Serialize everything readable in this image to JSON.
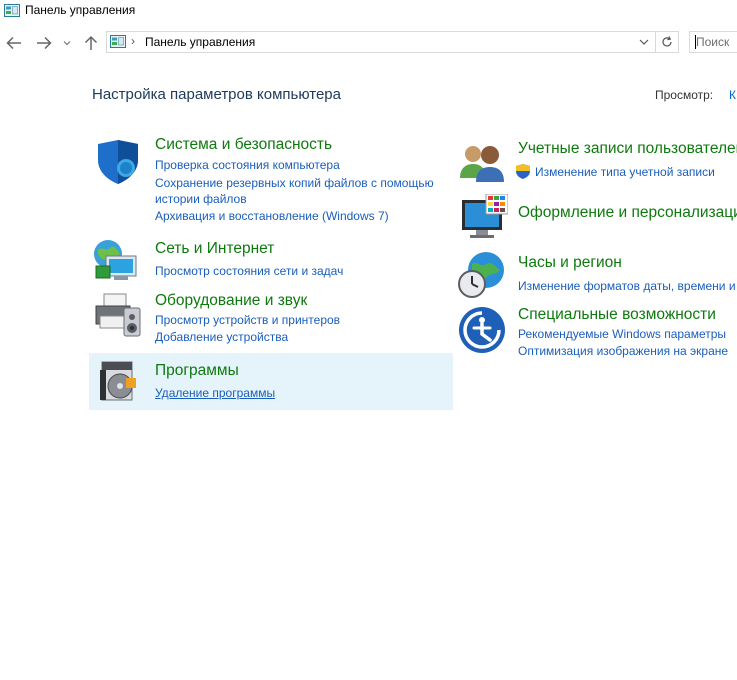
{
  "window": {
    "title": "Панель управления"
  },
  "nav": {
    "breadcrumb": "Панель управления",
    "search_placeholder": "Поиск"
  },
  "header": {
    "title": "Настройка параметров компьютера",
    "view_label": "Просмотр:",
    "view_value": "К"
  },
  "left_categories": [
    {
      "name": "Система и безопасность",
      "links": [
        "Проверка состояния компьютера",
        "Сохранение резервных копий файлов с помощью",
        "истории файлов",
        "Архивация и восстановление (Windows 7)"
      ]
    },
    {
      "name": "Сеть и Интернет",
      "links": [
        "Просмотр состояния сети и задач"
      ]
    },
    {
      "name": "Оборудование и звук",
      "links": [
        "Просмотр устройств и принтеров",
        "Добавление устройства"
      ]
    },
    {
      "name": "Программы",
      "links": [
        "Удаление программы"
      ]
    }
  ],
  "right_categories": [
    {
      "name": "Учетные записи пользователей",
      "links": [
        "Изменение типа учетной записи"
      ]
    },
    {
      "name": "Оформление и персонализация",
      "links": []
    },
    {
      "name": "Часы и регион",
      "links": [
        "Изменение форматов даты, времени и чисел"
      ]
    },
    {
      "name": "Специальные возможности",
      "links": [
        "Рекомендуемые Windows параметры",
        "Оптимизация изображения на экране"
      ]
    }
  ]
}
